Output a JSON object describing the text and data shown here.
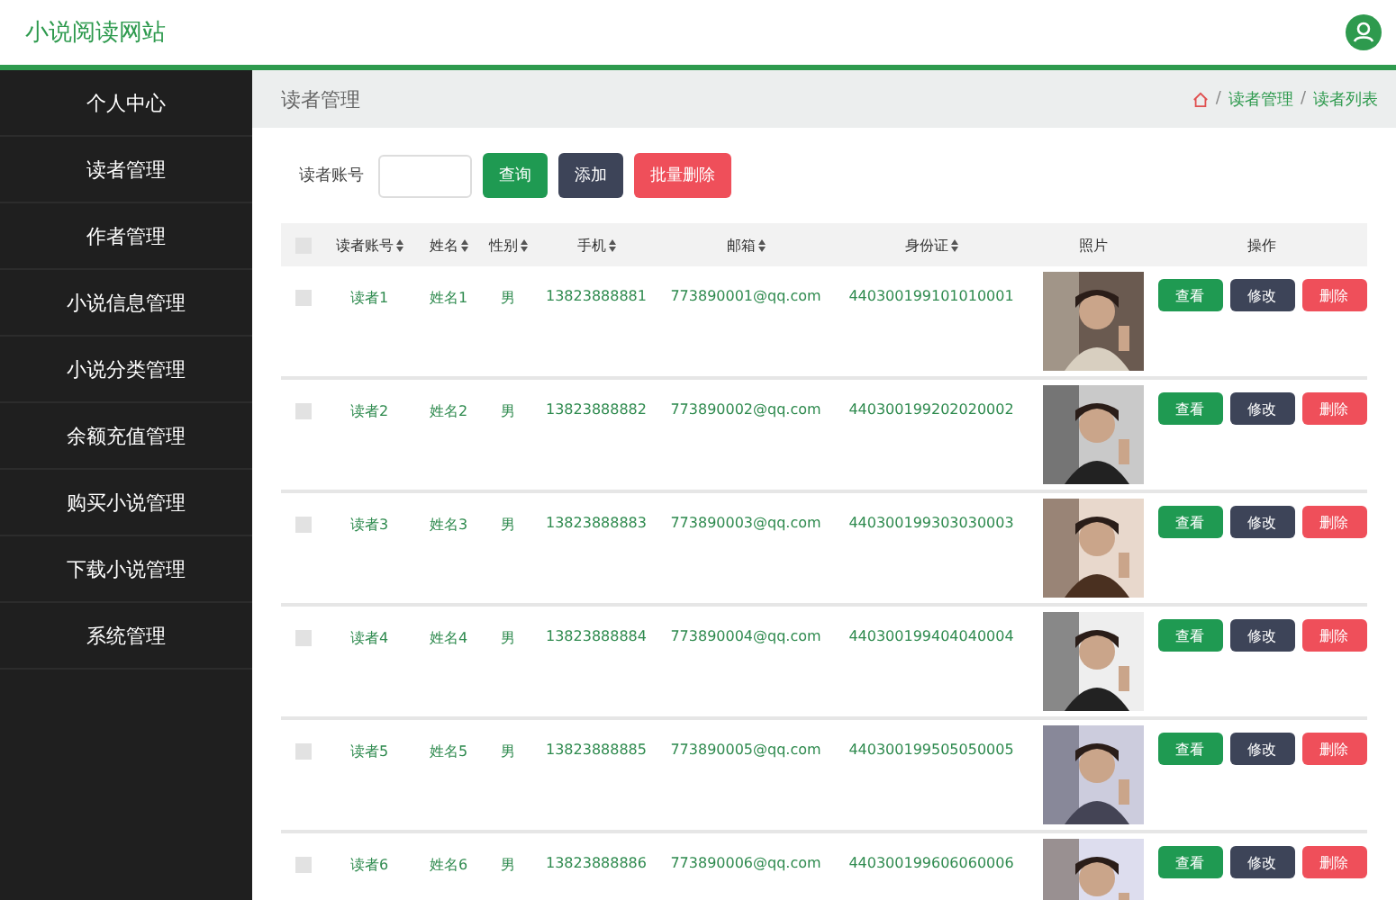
{
  "site_title": "小说阅读网站",
  "sidebar": {
    "items": [
      {
        "label": "个人中心"
      },
      {
        "label": "读者管理"
      },
      {
        "label": "作者管理"
      },
      {
        "label": "小说信息管理"
      },
      {
        "label": "小说分类管理"
      },
      {
        "label": "余额充值管理"
      },
      {
        "label": "购买小说管理"
      },
      {
        "label": "下载小说管理"
      },
      {
        "label": "系统管理"
      }
    ]
  },
  "page_title": "读者管理",
  "breadcrumb": [
    {
      "separator": "/",
      "label": "读者管理"
    },
    {
      "separator": "/",
      "label": "读者列表"
    }
  ],
  "search": {
    "label": "读者账号",
    "buttons": [
      {
        "label": "查询",
        "kind": "primary"
      },
      {
        "label": "添加",
        "kind": "dark"
      },
      {
        "label": "批量删除",
        "kind": "danger"
      }
    ]
  },
  "table": {
    "select_all_checked": false,
    "columns": [
      {
        "label": "读者账号",
        "sortable": true
      },
      {
        "label": "姓名",
        "sortable": true
      },
      {
        "label": "性别",
        "sortable": true
      },
      {
        "label": "手机",
        "sortable": true
      },
      {
        "label": "邮箱",
        "sortable": true
      },
      {
        "label": "身份证",
        "sortable": true
      },
      {
        "label": "照片",
        "sortable": false
      },
      {
        "label": "操作",
        "sortable": false
      }
    ],
    "rows": [
      {
        "checked": false,
        "cells": [
          "读者1",
          "姓名1",
          "男",
          "13823888881",
          "773890001@qq.com",
          "440300199101010001"
        ],
        "actions": [
          "查看",
          "修改",
          "删除"
        ]
      },
      {
        "checked": false,
        "cells": [
          "读者2",
          "姓名2",
          "男",
          "13823888882",
          "773890002@qq.com",
          "440300199202020002"
        ],
        "actions": [
          "查看",
          "修改",
          "删除"
        ]
      },
      {
        "checked": false,
        "cells": [
          "读者3",
          "姓名3",
          "男",
          "13823888883",
          "773890003@qq.com",
          "440300199303030003"
        ],
        "actions": [
          "查看",
          "修改",
          "删除"
        ]
      },
      {
        "checked": false,
        "cells": [
          "读者4",
          "姓名4",
          "男",
          "13823888884",
          "773890004@qq.com",
          "440300199404040004"
        ],
        "actions": [
          "查看",
          "修改",
          "删除"
        ]
      },
      {
        "checked": false,
        "cells": [
          "读者5",
          "姓名5",
          "男",
          "13823888885",
          "773890005@qq.com",
          "440300199505050005"
        ],
        "actions": [
          "查看",
          "修改",
          "删除"
        ]
      },
      {
        "checked": false,
        "cells": [
          "读者6",
          "姓名6",
          "男",
          "13823888886",
          "773890006@qq.com",
          "440300199606060006"
        ],
        "actions": [
          "查看",
          "修改",
          "删除"
        ]
      }
    ]
  }
}
